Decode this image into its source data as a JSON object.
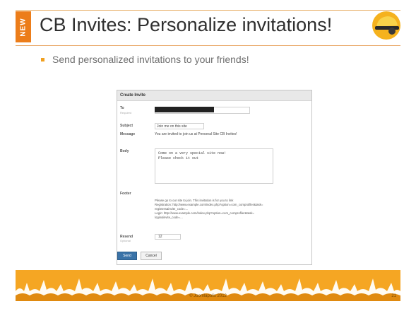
{
  "slide": {
    "side_tab": "NEW",
    "title": "CB Invites: Personalize invitations!",
    "bullet": "Send personalized invitations to your friends!"
  },
  "form": {
    "header": "Create Invite",
    "to_label": "To",
    "to_hint": "Required",
    "subject_label": "Subject",
    "subject_value": "Join me on this site",
    "message_label": "Message",
    "message_value": "You are invited to join us at Personal Site CB Invites!",
    "body_label": "Body",
    "body_lines": [
      "Come on a very special site now!",
      "Please check it out"
    ],
    "footer_label": "Footer",
    "footer_lines": [
      "Please go to our site to join. This invitation is for you to link",
      "Registration: http://www.example.com/index.php?option=com_comprofiler&task=",
      "registers&invite_code=...",
      "Login: http://www.example.com/index.php?option=com_comprofiler&task=",
      "login&invite_code=..."
    ],
    "resend_label": "Resend",
    "resend_hint": "Optional",
    "resend_value": "12",
    "send_button": "Send",
    "cancel_button": "Cancel"
  },
  "banner": {
    "copyright": "© Joomlapolis 2012",
    "page_number": "21"
  },
  "colors": {
    "accent": "#ec7d1a",
    "banner": "#f5a623",
    "send_button": "#3a73a8"
  },
  "icons": {
    "logo": "hardhat-icon"
  }
}
